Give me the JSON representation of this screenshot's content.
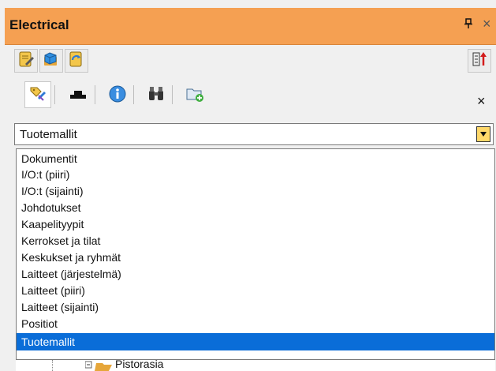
{
  "window": {
    "title": "Electrical",
    "pin_glyph": "Ȕ",
    "close_glyph": "×"
  },
  "toolbar": {
    "buttons": [
      {
        "icon": "document-edit-icon"
      },
      {
        "icon": "cube-folder-icon"
      },
      {
        "icon": "refresh-folder-icon"
      }
    ],
    "right_button_icon": "sort-order-icon"
  },
  "tabs": {
    "items": [
      {
        "icon": "tag-edit-icon"
      },
      {
        "icon": "flat-component-icon"
      },
      {
        "icon": "info-icon"
      },
      {
        "icon": "binoculars-icon"
      },
      {
        "icon": "new-folder-icon"
      }
    ],
    "close_glyph": "×"
  },
  "combo": {
    "value": "Tuotemallit"
  },
  "dropdown": {
    "options": [
      "Dokumentit",
      "I/O:t (piiri)",
      "I/O:t (sijainti)",
      "Johdotukset",
      "Kaapelityypit",
      "Kerrokset ja tilat",
      "Keskukset ja ryhmät",
      "Laitteet (järjestelmä)",
      "Laitteet (piiri)",
      "Laitteet (sijainti)",
      "Positiot",
      "Tuotemallit"
    ],
    "selected_index": 11
  },
  "tree": {
    "partial_item": "Pistorasia"
  },
  "colors": {
    "title_bar": "#f5a052",
    "selection": "#0a6dd8",
    "combo_button": "#ffd86a"
  }
}
